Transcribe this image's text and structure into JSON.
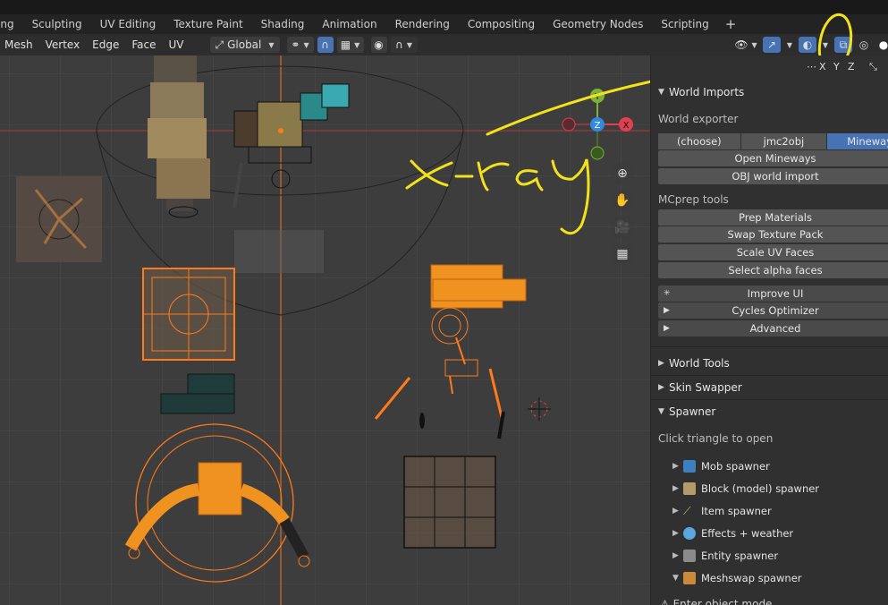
{
  "workspace_tabs": [
    "ing",
    "Sculpting",
    "UV Editing",
    "Texture Paint",
    "Shading",
    "Animation",
    "Rendering",
    "Compositing",
    "Geometry Nodes",
    "Scripting"
  ],
  "workspace_add": "+",
  "header": {
    "menus": [
      "Mesh",
      "Vertex",
      "Edge",
      "Face",
      "UV"
    ],
    "orientation": "Global"
  },
  "axis_toggles": [
    "X",
    "Y",
    "Z"
  ],
  "gizmo": {
    "y": "Y",
    "z": "Z",
    "x": "X"
  },
  "annotation_text": "x-ray",
  "panel": {
    "world_imports": "World Imports",
    "world_exporter_label": "World exporter",
    "exporters": [
      "(choose)",
      "jmc2obj",
      "Mineways"
    ],
    "exporter_selected": "Mineways",
    "open_mineways": "Open Mineways",
    "obj_import": "OBJ world import",
    "mcprep_tools_label": "MCprep tools",
    "tools": [
      "Prep Materials",
      "Swap Texture Pack",
      "Scale UV Faces",
      "Select alpha faces"
    ],
    "improve_ui": "Improve UI",
    "cycles_optimizer": "Cycles Optimizer",
    "advanced": "Advanced",
    "world_tools": "World Tools",
    "skin_swapper": "Skin Swapper",
    "spawner": "Spawner",
    "spawner_hint": "Click triangle to open",
    "spawners": [
      {
        "label": "Mob spawner",
        "icon": "mob-cube-icon",
        "color": "#3d7fbf"
      },
      {
        "label": "Block (model) spawner",
        "icon": "block-icon",
        "color": "#b59a6a"
      },
      {
        "label": "Item spawner",
        "icon": "sword-icon",
        "color": "#9bd35a"
      },
      {
        "label": "Effects + weather",
        "icon": "effects-icon",
        "color": "#5aa7e0"
      },
      {
        "label": "Entity spawner",
        "icon": "entity-icon",
        "color": "#8a8a8a"
      },
      {
        "label": "Meshswap spawner",
        "icon": "meshswap-icon",
        "color": "#c98a3a"
      }
    ],
    "footer_partial": "Enter object mode"
  },
  "colors": {
    "accent": "#4772b3",
    "annotation": "#f3e21a",
    "selection": "#ff7a1a",
    "axis_x": "#e04050",
    "axis_y": "#7bb33a",
    "axis_z": "#2f8ae0"
  }
}
